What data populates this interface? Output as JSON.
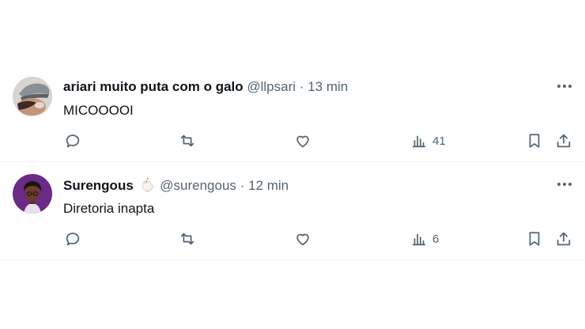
{
  "posts": [
    {
      "display_name": "ariari muito puta com o galo",
      "handle": "@llpsari",
      "separator": "·",
      "time": "13 min",
      "text": "MICOOOOI",
      "views": "41",
      "avatar_icon": "avatar-photo-cap"
    },
    {
      "display_name": "Surengous",
      "name_emoji": "chicken",
      "handle": "@surengous",
      "separator": "·",
      "time": "12 min",
      "text": "Diretoria inapta",
      "views": "6",
      "avatar_icon": "avatar-cartoon-purple"
    }
  ],
  "colors": {
    "text_primary": "#0f1419",
    "text_secondary": "#536471",
    "divider": "#eff3f4",
    "avatar2_bg": "#6b2a86"
  }
}
